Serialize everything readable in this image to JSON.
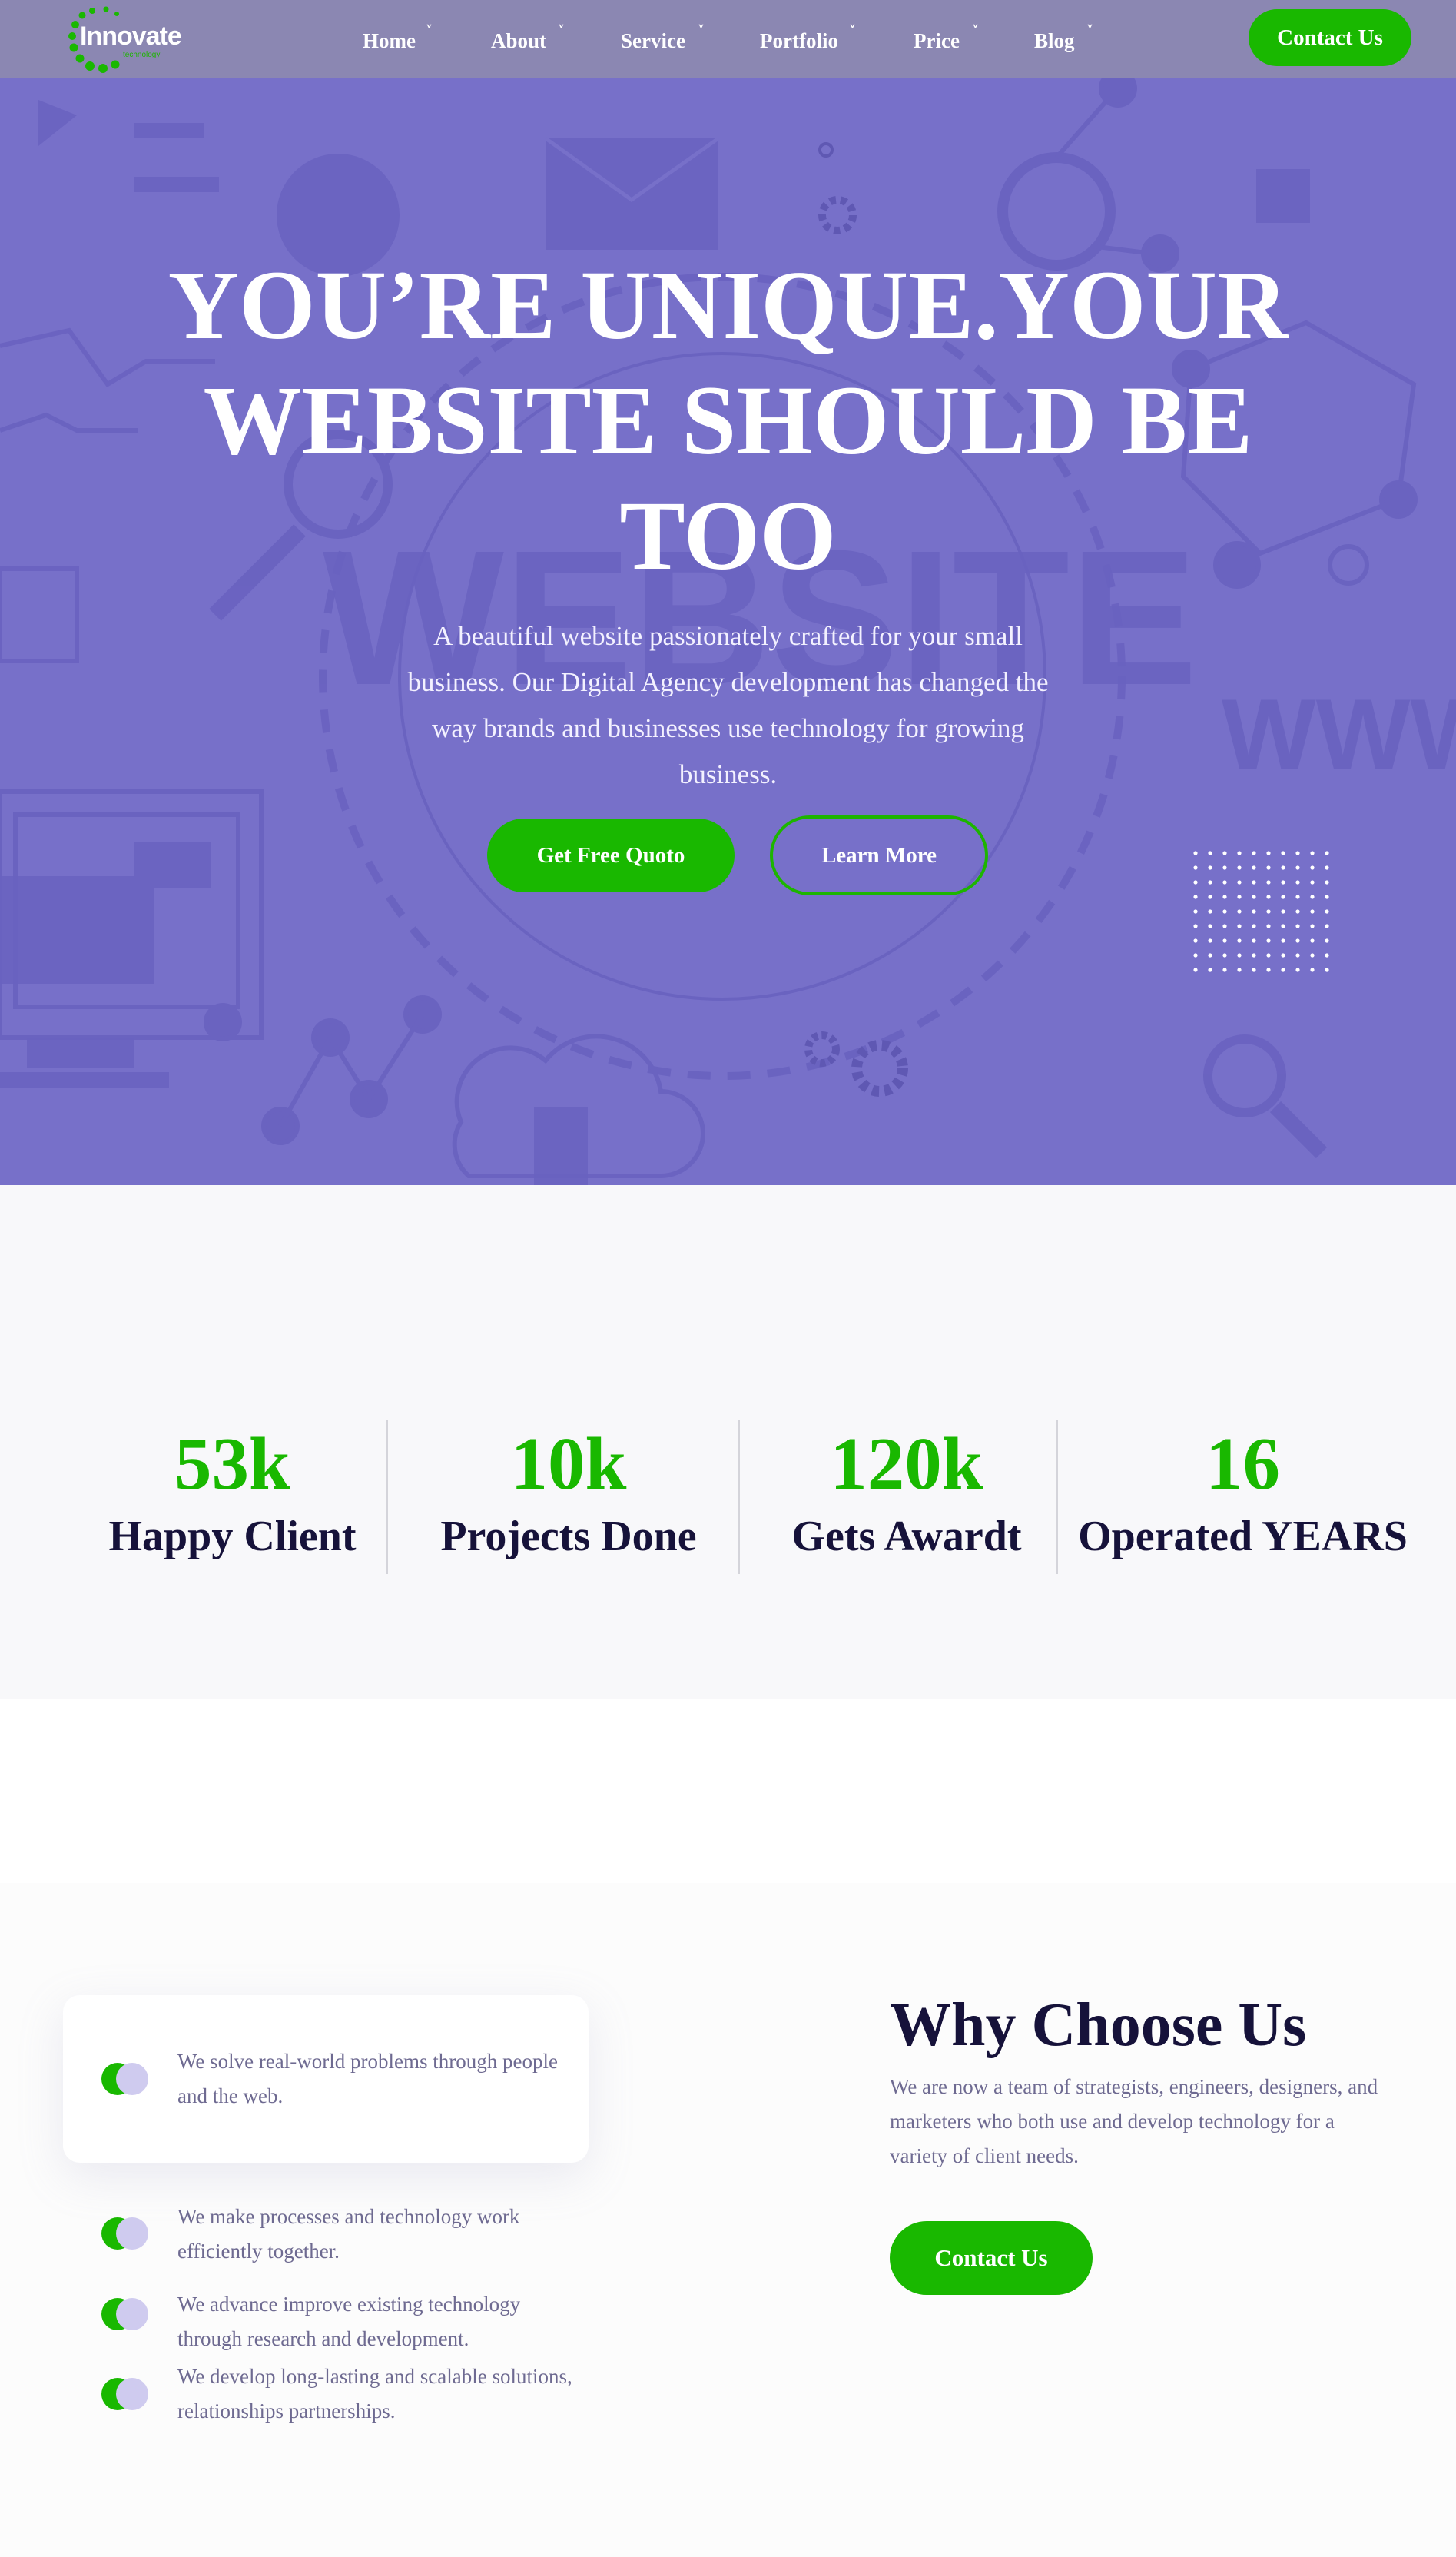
{
  "brand": {
    "name": "Innovate",
    "tagline": "technology",
    "accent": "#19b800",
    "hero_bg": "#7770c9"
  },
  "nav": {
    "items": [
      {
        "label": "Home",
        "chevron": "˅"
      },
      {
        "label": "About",
        "chevron": "˅"
      },
      {
        "label": "Service",
        "chevron": "˅"
      },
      {
        "label": "Portfolio",
        "chevron": "˅"
      },
      {
        "label": "Price",
        "chevron": "˅"
      },
      {
        "label": "Blog",
        "chevron": "˅"
      }
    ],
    "cta": "Contact Us"
  },
  "hero": {
    "title_line1": "YOU’RE UNIQUE.YOUR",
    "title_line2": "WEBSITE SHOULD BE",
    "title_line3": "TOO",
    "subtitle": "A beautiful website passionately crafted for your small business. Our Digital Agency development has changed the way brands and businesses use technology for growing business.",
    "btn_primary": "Get Free Quoto",
    "btn_secondary": "Learn More",
    "bg_word": "WEBSITE",
    "bg_www": "WWW"
  },
  "stats": [
    {
      "value": "53k",
      "label": "Happy Client"
    },
    {
      "value": "10k",
      "label": "Projects Done"
    },
    {
      "value": "120k",
      "label": "Gets Awardt"
    },
    {
      "value": "16",
      "label": "Operated YEARS"
    }
  ],
  "why": {
    "title": "Why Choose Us",
    "description": "We are now a team of strategists, engineers, designers, and marketers who both use and develop technology for a variety of client needs.",
    "cta": "Contact Us",
    "features": [
      "We solve real-world problems through people and the web.",
      "We make processes and technology work efficiently together.",
      "We advance improve existing technology through research and development.",
      "We develop long-lasting and scalable solutions, relationships partnerships."
    ]
  }
}
